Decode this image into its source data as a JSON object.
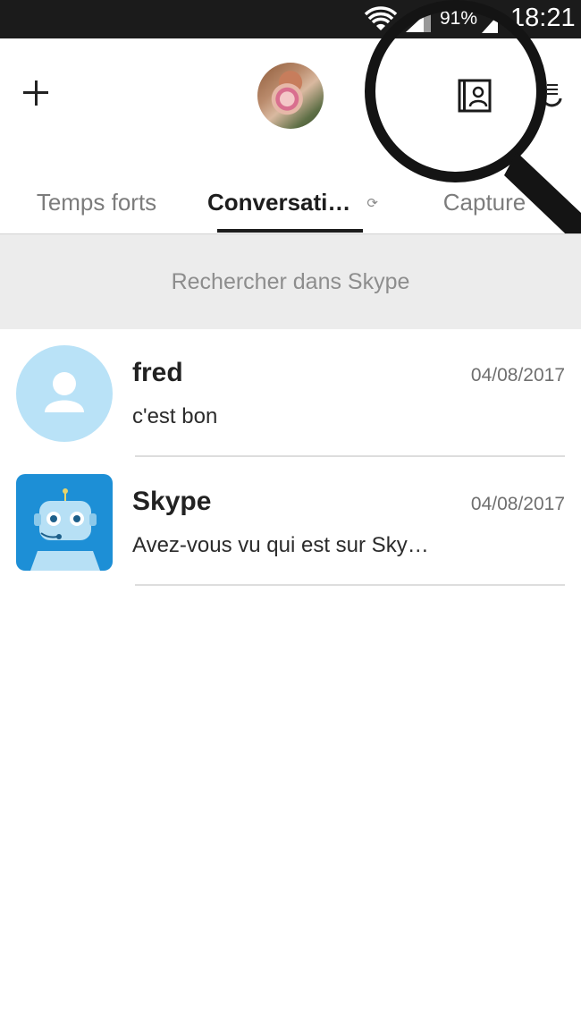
{
  "status_bar": {
    "battery_percent": "91%",
    "time": "18:21",
    "icons": [
      "wifi-icon",
      "signal-icon",
      "battery-icon"
    ]
  },
  "header": {
    "add_icon": "plus-icon",
    "avatar_icon": "profile-avatar",
    "contacts_icon": "contacts-book-icon",
    "menu_icon": "menu-icon"
  },
  "tabs": [
    {
      "label": "Temps forts",
      "active": false
    },
    {
      "label": "Conversati…",
      "active": true,
      "status_icon": "sync-icon"
    },
    {
      "label": "Capture",
      "active": false
    }
  ],
  "search": {
    "placeholder": "Rechercher dans Skype"
  },
  "conversations": [
    {
      "name": "fred",
      "date": "04/08/2017",
      "preview": "c'est bon",
      "avatar": "default-user-icon"
    },
    {
      "name": "Skype",
      "date": "04/08/2017",
      "preview": "Avez-vous vu qui est sur Sky…",
      "avatar": "skype-bot-icon"
    }
  ],
  "colors": {
    "status_bar_bg": "#1b1b1b",
    "active_tab": "#1d1d1d",
    "inactive_tab": "#7c7c7c",
    "search_bg": "#ececec",
    "default_avatar_bg": "#b9e2f7",
    "bot_avatar_bg": "#1d8fd6"
  }
}
